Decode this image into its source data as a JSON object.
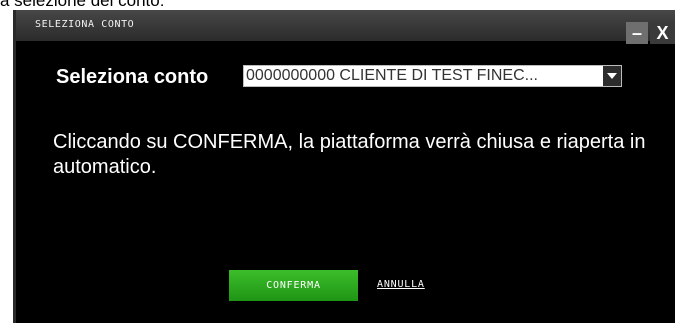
{
  "page": {
    "caption": "a selezione del conto:"
  },
  "dialog": {
    "title": "SELEZIONA CONTO",
    "minimize_label": "–",
    "close_label": "X",
    "account_label": "Seleziona conto",
    "account_select": {
      "selected_value": "0000000000 CLIENTE DI TEST FINEC..."
    },
    "message": "Cliccando su CONFERMA, la piattaforma verrà chiusa e riaperta in automatico.",
    "confirm_label": "CONFERMA",
    "cancel_label": "ANNULLA"
  },
  "colors": {
    "dialog_background": "#000000",
    "titlebar": "#3a3a3a",
    "confirm_button": "#2ea81f"
  }
}
